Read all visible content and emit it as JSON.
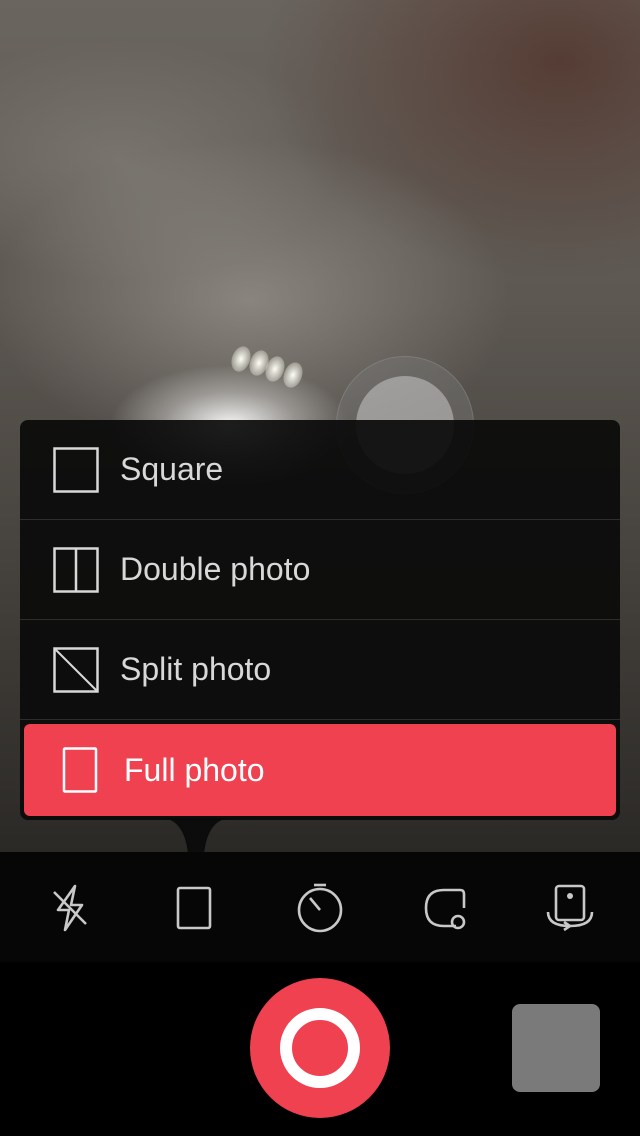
{
  "colors": {
    "accent": "#ef4150",
    "menu_background": "#0a0a0a",
    "menu_text": "#d8d8d8",
    "toolbar_icon": "#c8c8c8",
    "thumbnail": "#7a7a7a"
  },
  "format_menu": {
    "items": [
      {
        "label": "Square",
        "icon": "square-icon",
        "selected": false
      },
      {
        "label": "Double photo",
        "icon": "double-photo-icon",
        "selected": false
      },
      {
        "label": "Split photo",
        "icon": "split-photo-icon",
        "selected": false
      },
      {
        "label": "Full photo",
        "icon": "full-photo-icon",
        "selected": true
      }
    ]
  },
  "toolbar": {
    "tools": [
      {
        "name": "flash-off",
        "icon": "flash-off-icon"
      },
      {
        "name": "format",
        "icon": "portrait-frame-icon"
      },
      {
        "name": "timer",
        "icon": "timer-icon"
      },
      {
        "name": "overlay",
        "icon": "overlay-shape-icon"
      },
      {
        "name": "switch-camera",
        "icon": "switch-camera-icon"
      }
    ]
  },
  "bottom_bar": {
    "shutter_icon": "shutter-ring-icon",
    "gallery_icon": "gallery-thumbnail"
  }
}
